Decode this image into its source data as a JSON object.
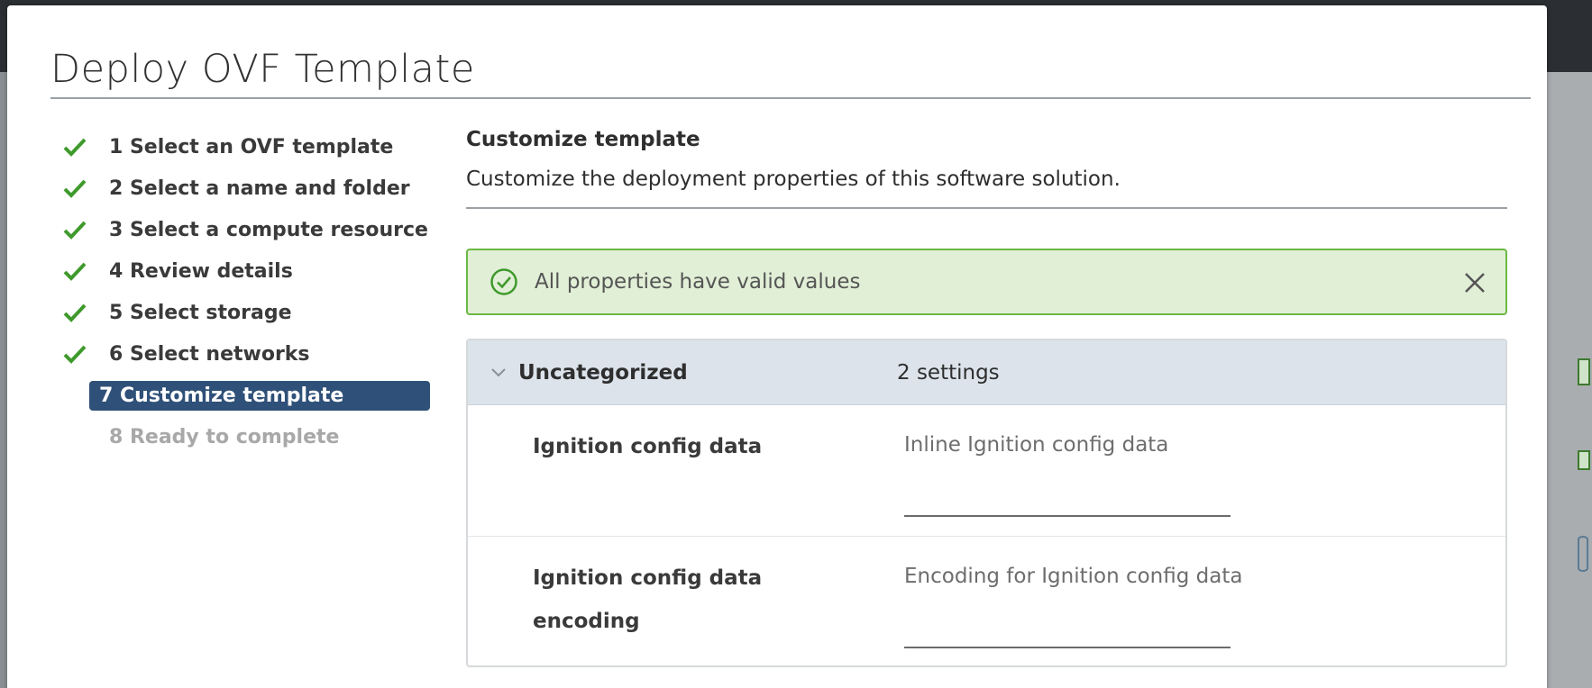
{
  "modal": {
    "title": "Deploy OVF Template"
  },
  "steps": [
    {
      "label": "1 Select an OVF template",
      "state": "done"
    },
    {
      "label": "2 Select a name and folder",
      "state": "done"
    },
    {
      "label": "3 Select a compute resource",
      "state": "done"
    },
    {
      "label": "4 Review details",
      "state": "done"
    },
    {
      "label": "5 Select storage",
      "state": "done"
    },
    {
      "label": "6 Select networks",
      "state": "done"
    },
    {
      "label": "7 Customize template",
      "state": "active"
    },
    {
      "label": "8 Ready to complete",
      "state": "disabled"
    }
  ],
  "content": {
    "title": "Customize template",
    "description": "Customize the deployment properties of this software solution.",
    "alert": {
      "message": "All properties have valid values",
      "icon": "check-circle-icon",
      "close_icon": "close-icon"
    },
    "group": {
      "name": "Uncategorized",
      "count": "2 settings",
      "icon": "chevron-down-icon"
    },
    "properties": [
      {
        "name": "Ignition config data",
        "description": "Inline Ignition config data",
        "value": ""
      },
      {
        "name": "Ignition config data encoding",
        "description": "Encoding for Ignition config data",
        "value": ""
      }
    ]
  },
  "colors": {
    "accent": "#2f5078",
    "success": "#6cb844",
    "success_bg": "#e1efd6",
    "check": "#3f9a2c"
  }
}
